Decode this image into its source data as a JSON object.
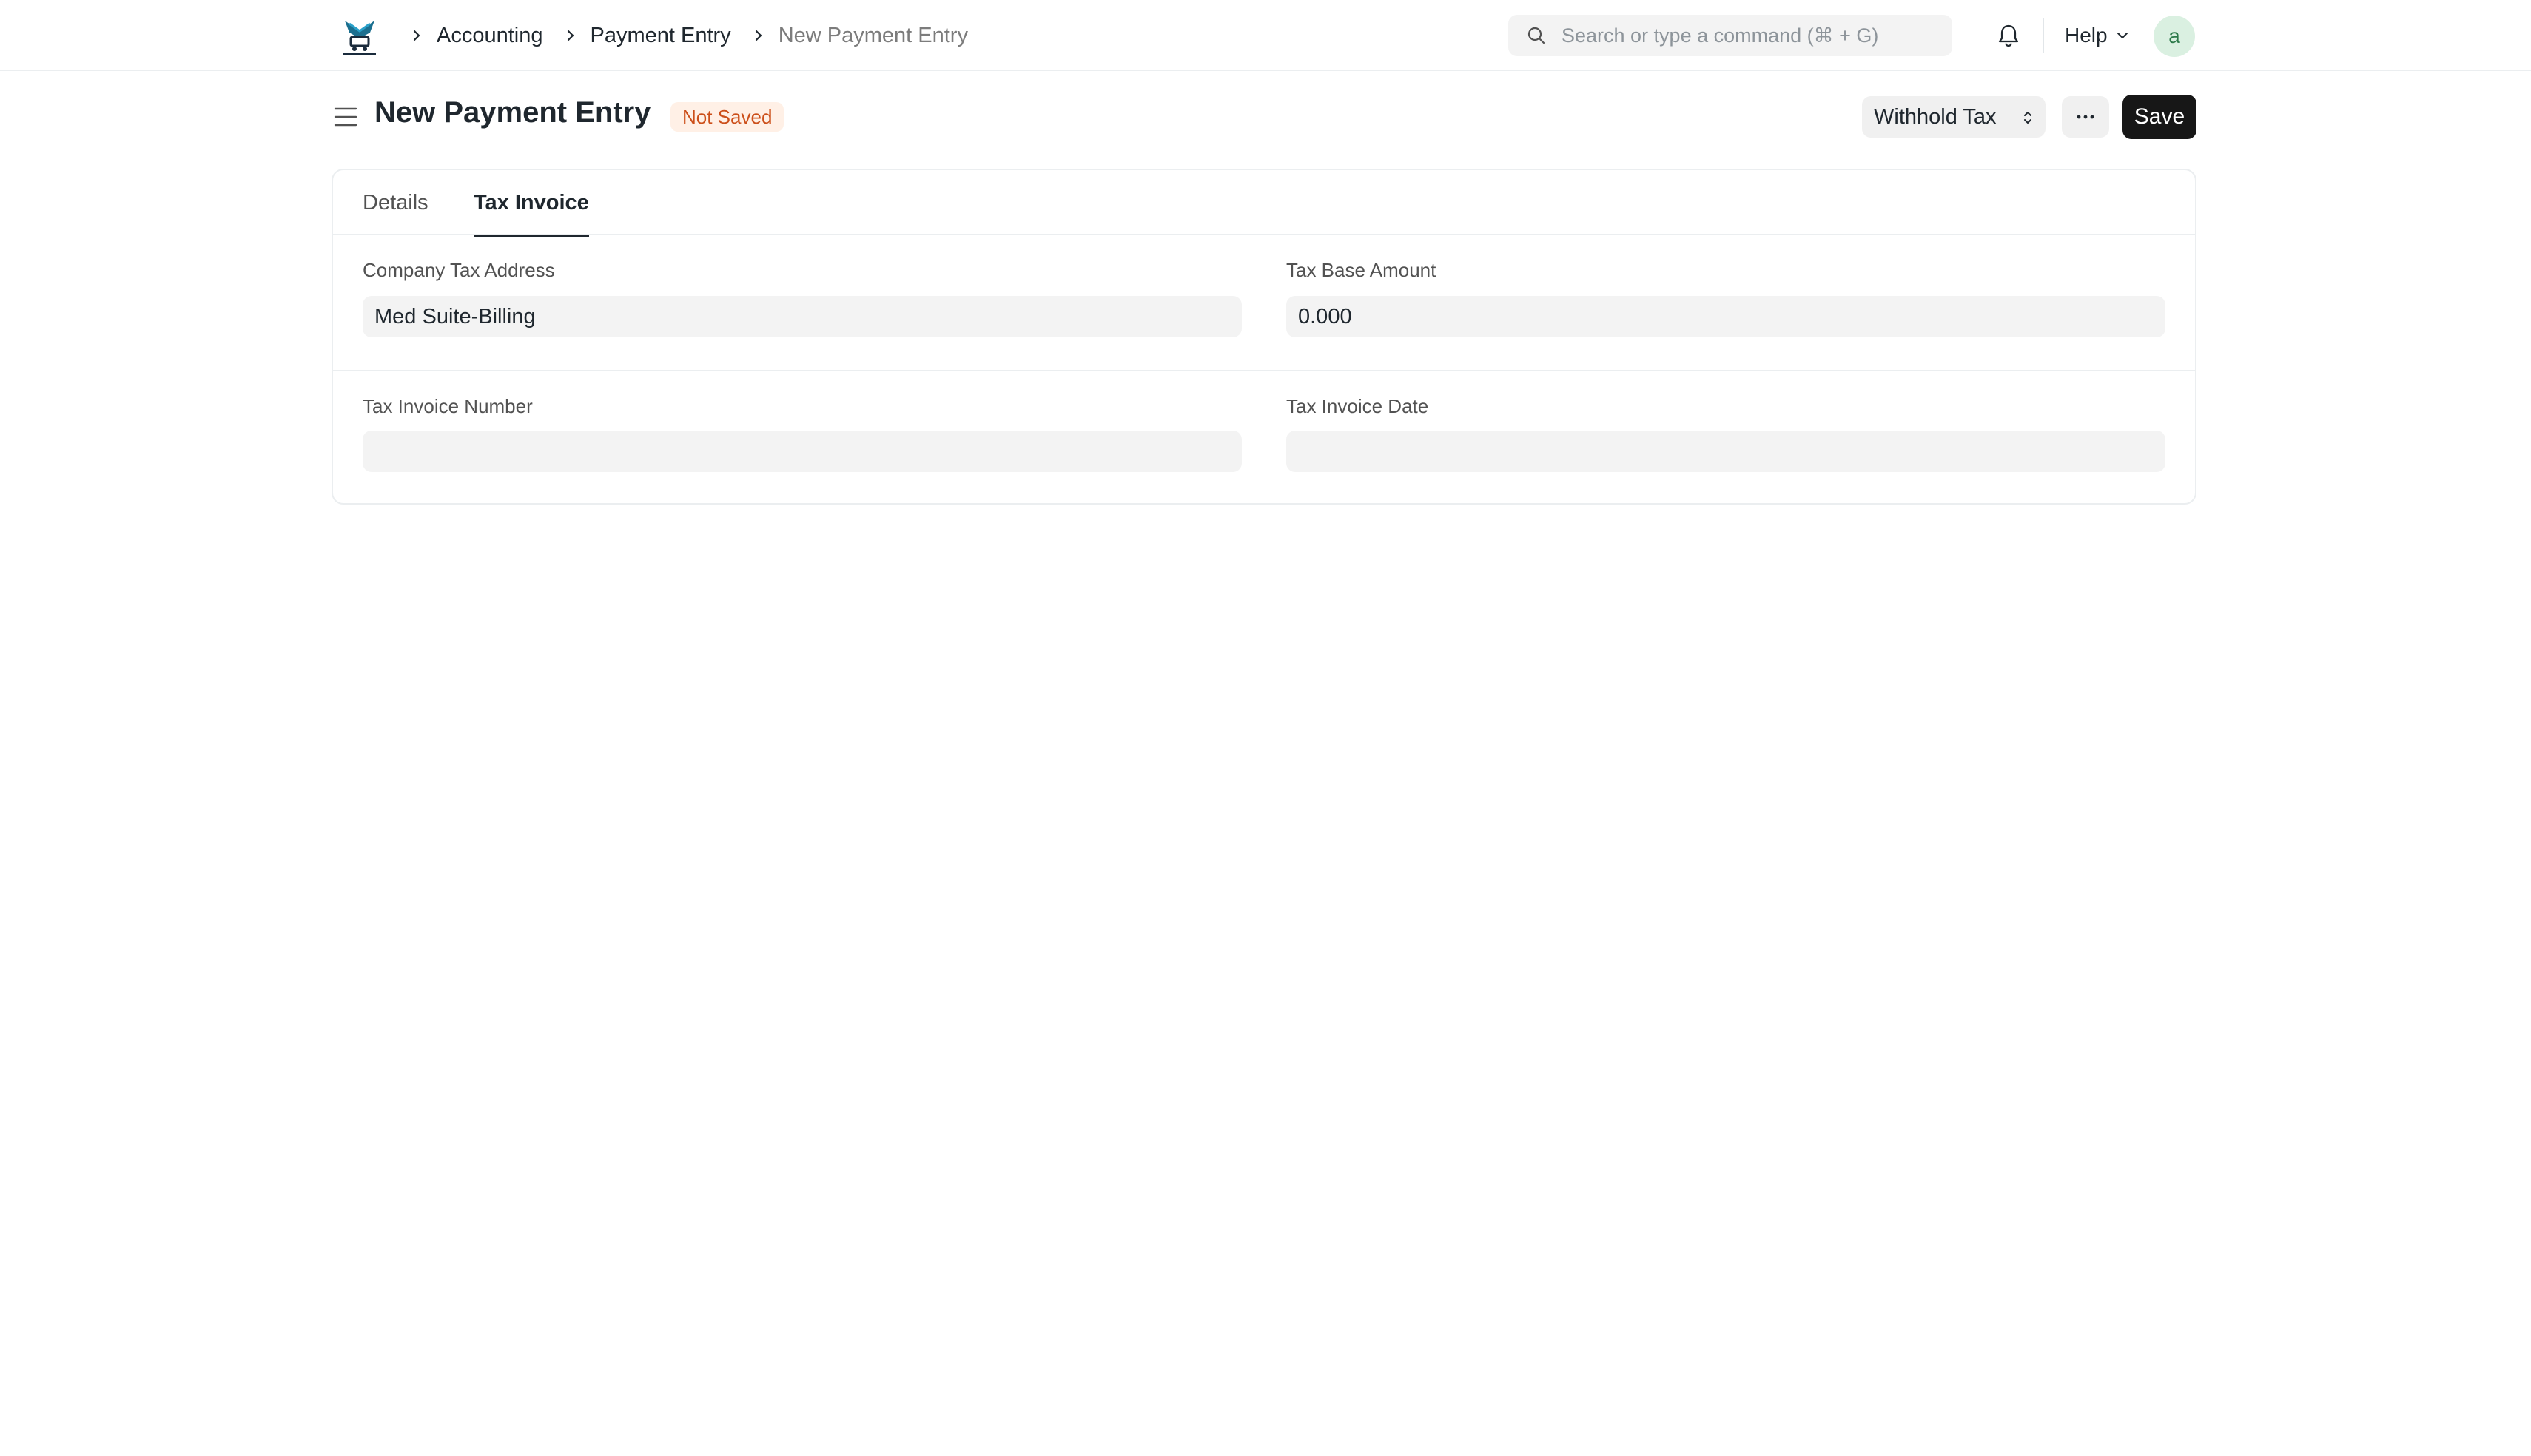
{
  "navbar": {
    "logo_icon": "app-logo-icon",
    "breadcrumb": [
      "Accounting",
      "Payment Entry",
      "New Payment Entry"
    ],
    "search_placeholder": "Search or type a command (⌘ + G)",
    "help_label": "Help",
    "avatar_letter": "a"
  },
  "page": {
    "title": "New Payment Entry",
    "status": "Not Saved",
    "withhold_select_value": "Withhold Tax",
    "more_label": "···",
    "save_label": "Save"
  },
  "tabs": [
    {
      "label": "Details",
      "active": false
    },
    {
      "label": "Tax Invoice",
      "active": true
    }
  ],
  "form": {
    "company_tax_address": {
      "label": "Company Tax Address",
      "value": "Med Suite-Billing"
    },
    "tax_base_amount": {
      "label": "Tax Base Amount",
      "value": "0.000"
    },
    "tax_invoice_number": {
      "label": "Tax Invoice Number",
      "value": ""
    },
    "tax_invoice_date": {
      "label": "Tax Invoice Date",
      "value": ""
    }
  },
  "colors": {
    "status_badge_bg": "#fff0e6",
    "status_badge_text": "#cc4f1a",
    "primary_button": "#171717",
    "avatar_bg": "#daf0e1"
  }
}
